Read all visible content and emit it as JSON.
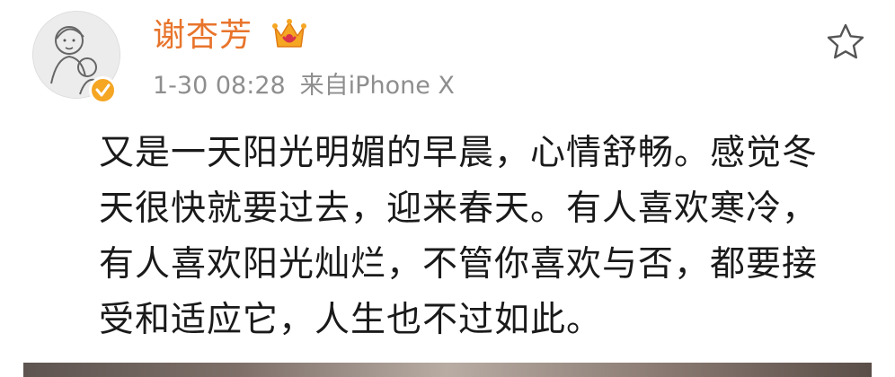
{
  "post": {
    "author": {
      "name": "谢杏芳",
      "avatar_icon": "avatar-image",
      "verified_icon": "verified-badge-icon",
      "vip_icon": "vip-crown-icon"
    },
    "timestamp": "1-30 08:28",
    "source": "来自iPhone X",
    "star_icon": "star-outline-icon",
    "text_lines": [
      "又是一天阳光明媚的早晨，心情舒畅。感觉冬",
      "天很快就要过去，迎来春天。有人喜欢寒冷，",
      "有人喜欢阳光灿烂，不管你喜欢与否，都要接",
      "受和适应它，人生也不过如此。"
    ]
  },
  "colors": {
    "author_name": "#e8742c",
    "meta_text": "#8e8e8e",
    "body_text": "#1a1a1a",
    "verified_badge": "#f5a623"
  }
}
